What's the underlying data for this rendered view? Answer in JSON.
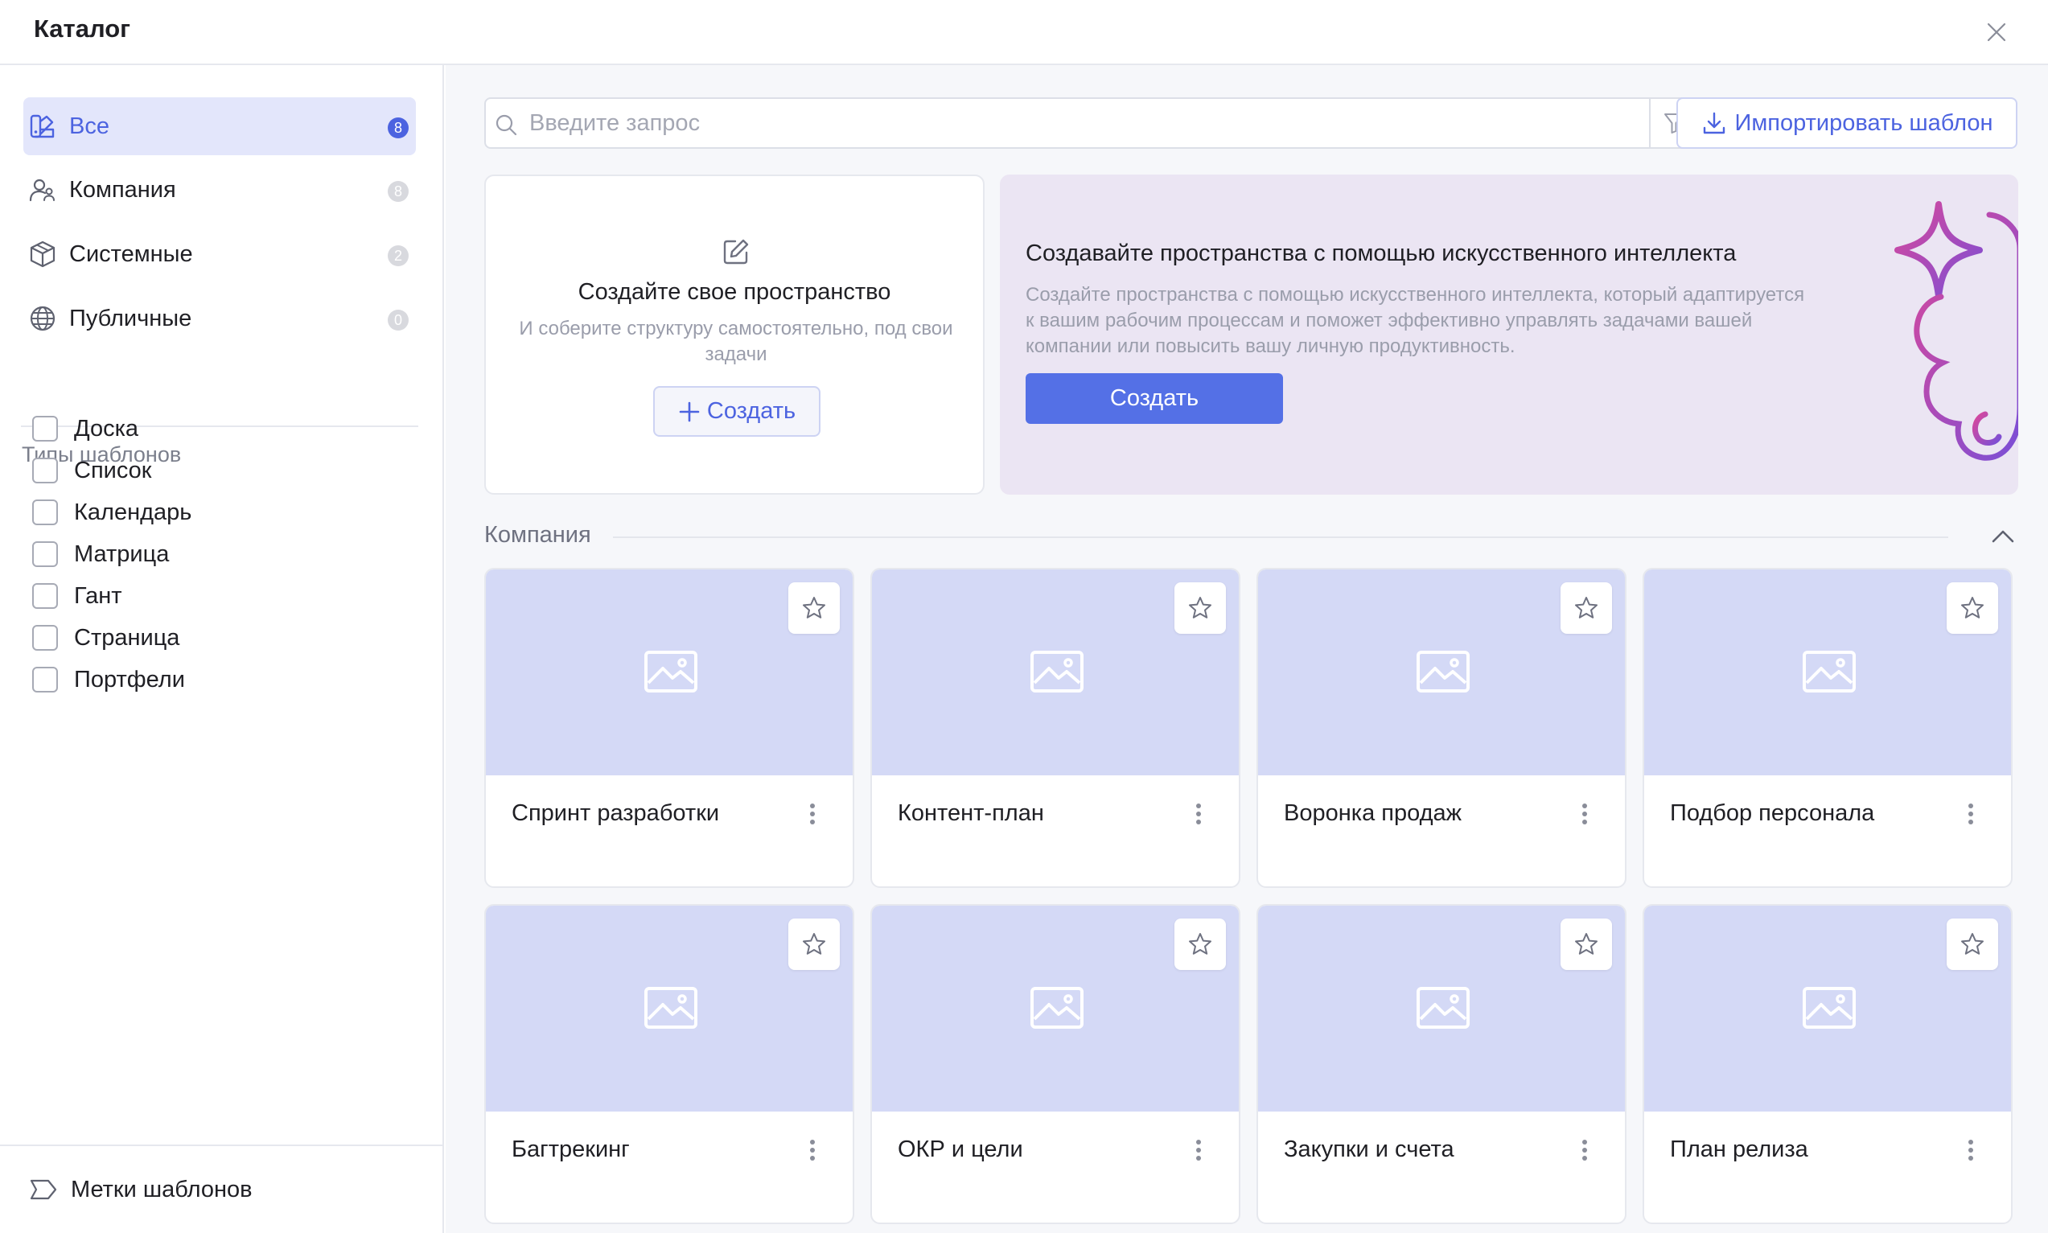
{
  "window": {
    "title": "Каталог"
  },
  "sidebar": {
    "items": [
      {
        "label": "Все",
        "count": "8",
        "icon": "palette-icon",
        "active": true
      },
      {
        "label": "Компания",
        "count": "8",
        "icon": "users-icon"
      },
      {
        "label": "Системные",
        "count": "2",
        "icon": "box-icon"
      },
      {
        "label": "Публичные",
        "count": "0",
        "icon": "globe-icon"
      }
    ],
    "types_heading": "Типы шаблонов",
    "types": [
      "Доска",
      "Список",
      "Календарь",
      "Матрица",
      "Гант",
      "Страница",
      "Портфели"
    ],
    "tags_label": "Метки шаблонов"
  },
  "search": {
    "placeholder": "Введите запрос",
    "value": ""
  },
  "import_button": {
    "label": "Импортировать шаблон"
  },
  "create_card": {
    "title": "Создайте свое пространство",
    "subtitle": "И соберите структуру самостоятельно, под свои задачи",
    "button": "Создать"
  },
  "ai_card": {
    "title": "Создавайте пространства с помощью искусственного интеллекта",
    "description": "Создайте пространства с помощью искусственного интеллекта, который адаптируется к вашим рабочим процессам и поможет эффективно управлять задачами вашей компании или повысить вашу личную продуктивность.",
    "button": "Создать"
  },
  "section": {
    "title": "Компания"
  },
  "templates": [
    {
      "name": "Спринт разработки"
    },
    {
      "name": "Контент-план"
    },
    {
      "name": "Воронка продаж"
    },
    {
      "name": "Подбор персонала"
    },
    {
      "name": "Багтрекинг"
    },
    {
      "name": "ОКР и цели"
    },
    {
      "name": "Закупки и счета"
    },
    {
      "name": "План релиза"
    }
  ],
  "colors": {
    "accent": "#4c63e0",
    "ai_button": "#5470e6",
    "thumb": "#d4d9f6",
    "ai_bg": "#ebe5f3",
    "ai_gradient_start": "#d9489b",
    "ai_gradient_end": "#7a4fd6"
  }
}
